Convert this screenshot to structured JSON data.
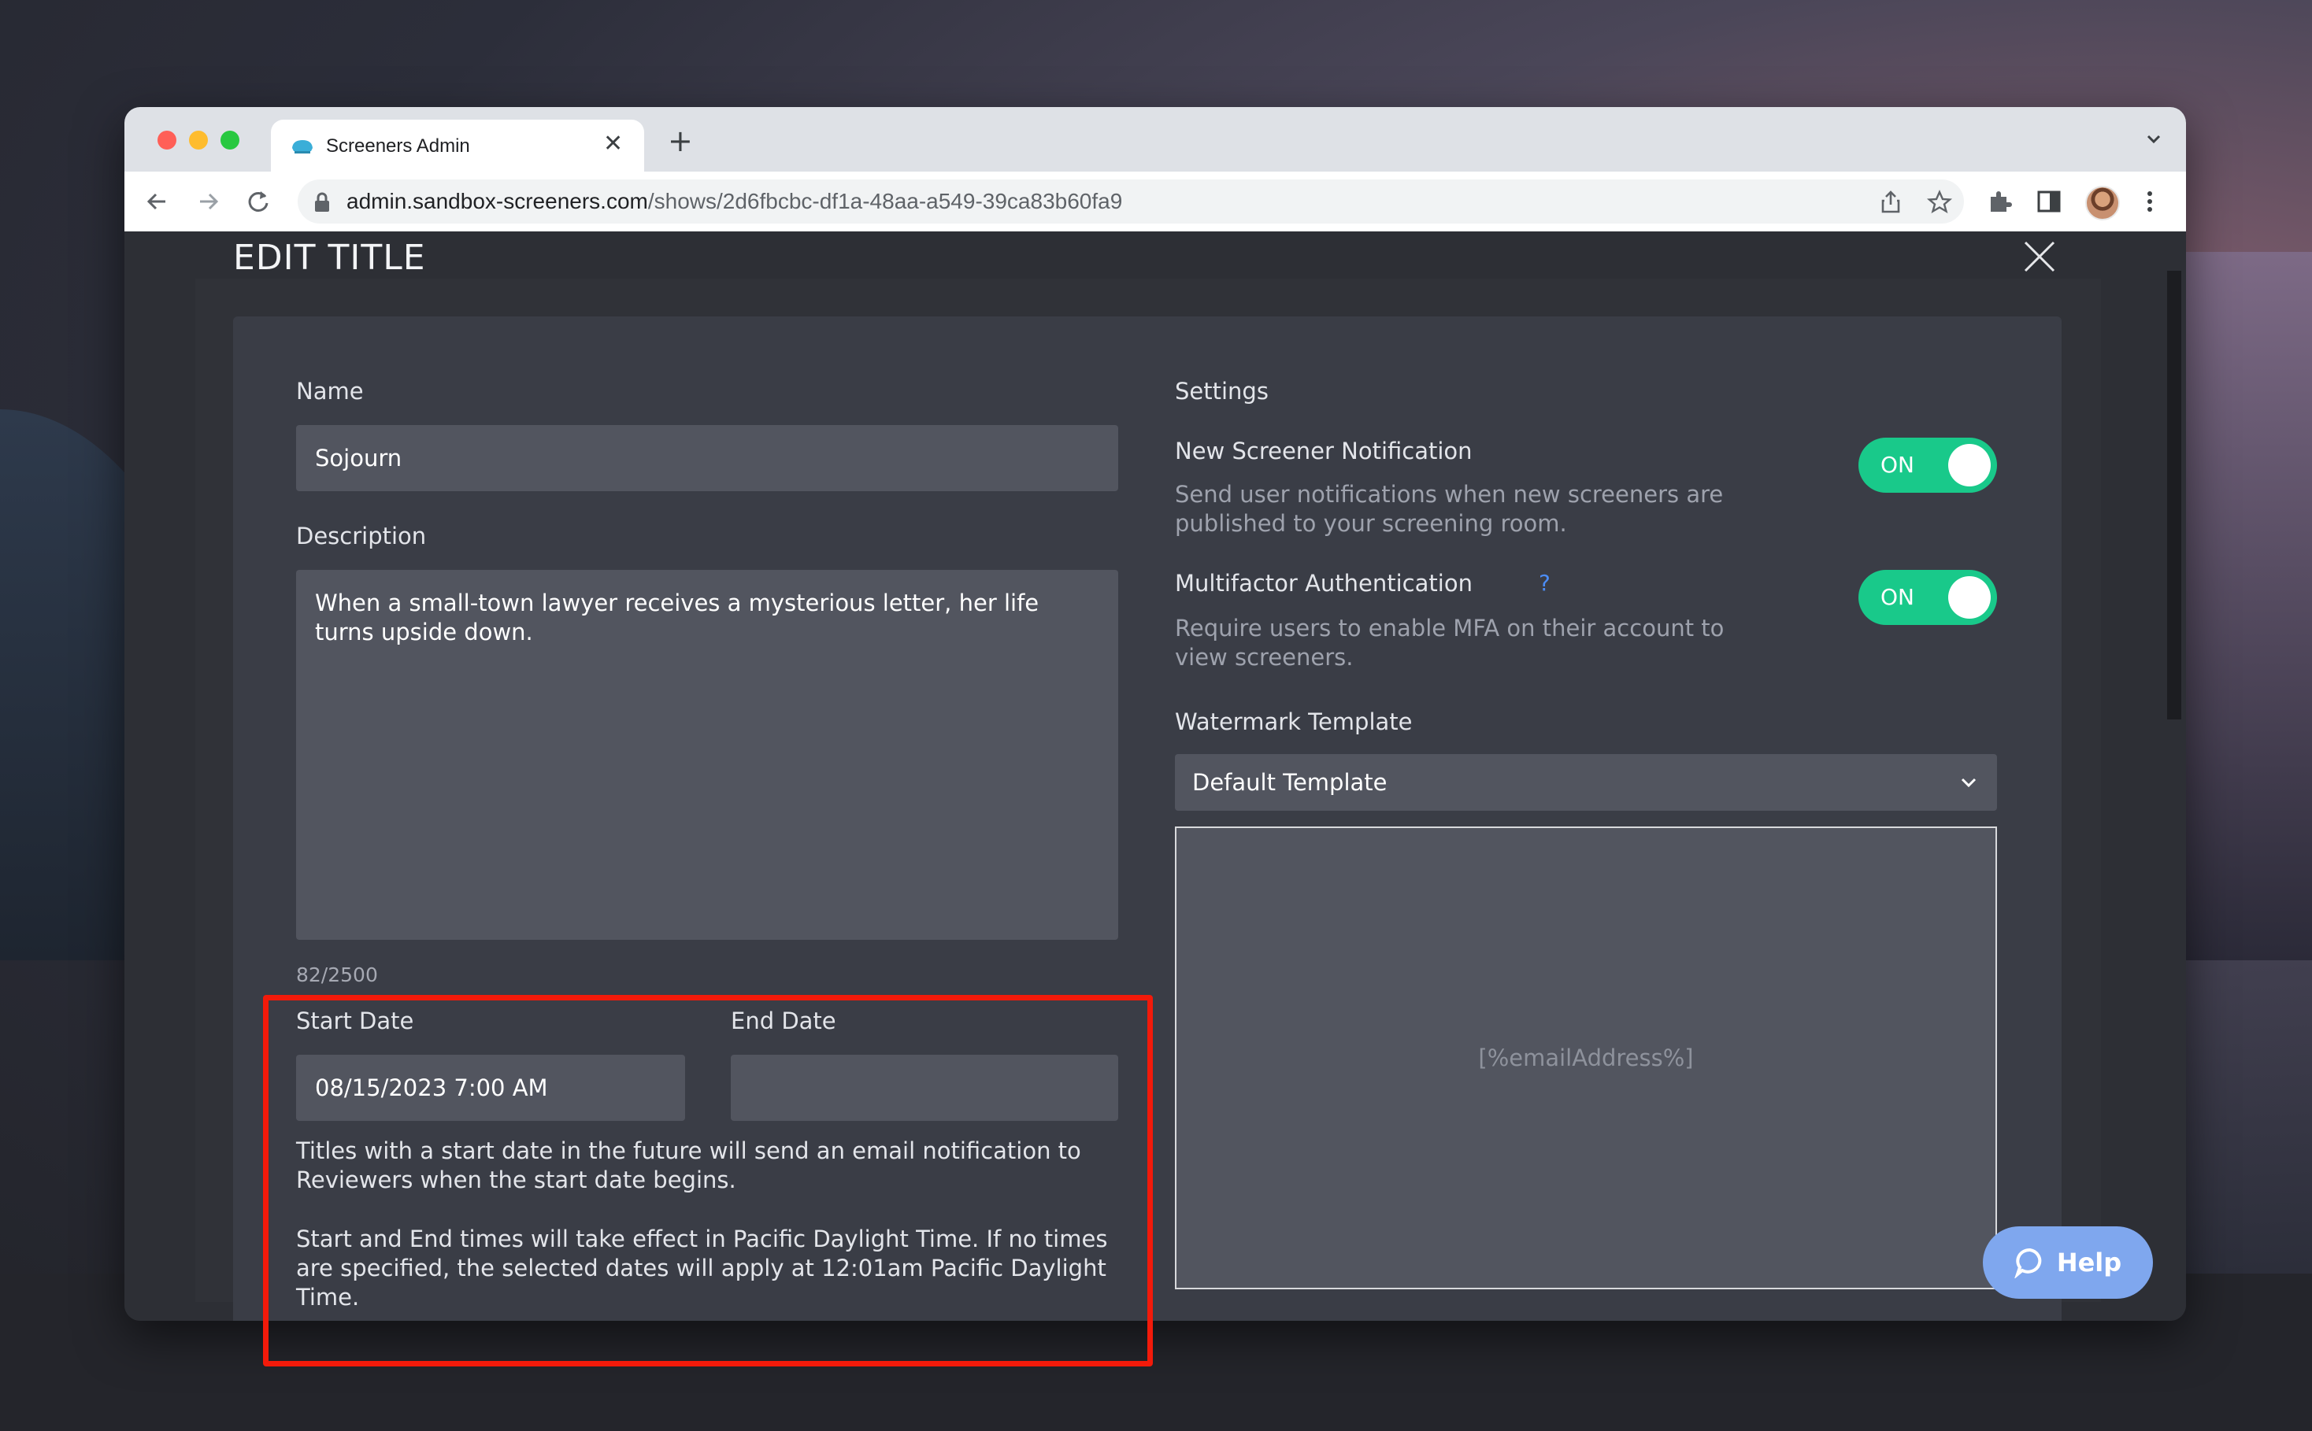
{
  "browser": {
    "tab_title": "Screeners Admin",
    "url_domain": "admin.sandbox-screeners.com",
    "url_path": "/shows/2d6fbcbc-df1a-48aa-a549-39ca83b60fa9"
  },
  "modal": {
    "title": "EDIT TITLE"
  },
  "form": {
    "name_label": "Name",
    "name_value": "Sojourn",
    "description_label": "Description",
    "description_value": "When a small-town lawyer receives a mysterious letter, her life turns upside down.",
    "description_counter": "82/2500",
    "start_date_label": "Start Date",
    "start_date_value": "08/15/2023 7:00 AM",
    "end_date_label": "End Date",
    "end_date_value": "",
    "help_text_1": "Titles with a start date in the future will send an email notification to Reviewers when the start date begins.",
    "help_text_2": "Start and End times will take effect in Pacific Daylight Time. If no times are specified, the selected dates will apply at 12:01am Pacific Daylight Time."
  },
  "settings": {
    "heading": "Settings",
    "notification_label": "New Screener Notification",
    "notification_desc": "Send user notifications when new screeners are published to your screening room.",
    "notification_toggle": "ON",
    "mfa_label": "Multifactor Authentication",
    "mfa_help": "?",
    "mfa_desc": "Require users to enable MFA on their account to view screeners.",
    "mfa_toggle": "ON",
    "watermark_label": "Watermark Template",
    "watermark_selected": "Default Template",
    "watermark_preview": "[%emailAddress%]"
  },
  "help_button": {
    "label": "Help"
  },
  "colors": {
    "toggle_on": "#19c98a",
    "highlight": "#f21a0a",
    "help_button": "#7fa7ee",
    "panel": "#3a3d46",
    "field": "#52555f"
  },
  "icons": [
    "tab-favicon-icon",
    "close-icon",
    "plus-icon",
    "chevron-down-icon",
    "back-arrow-icon",
    "forward-arrow-icon",
    "reload-icon",
    "lock-icon",
    "share-icon",
    "star-icon",
    "extensions-icon",
    "sidepanel-icon",
    "kebab-menu-icon",
    "chat-bubble-icon"
  ]
}
